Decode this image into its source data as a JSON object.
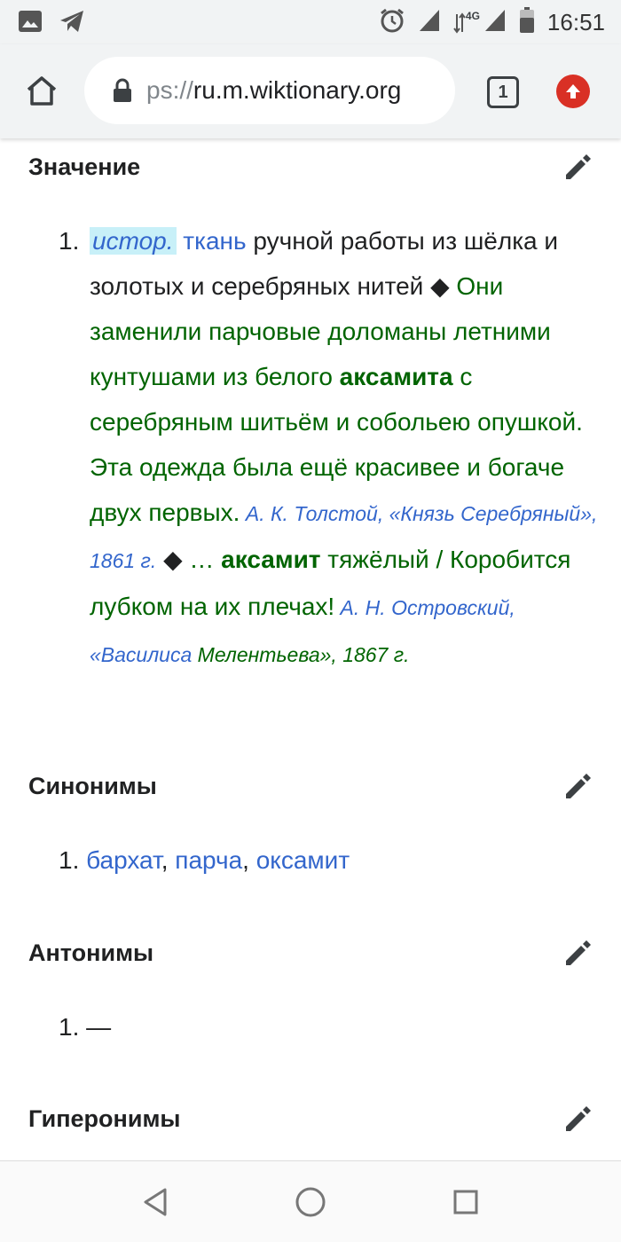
{
  "status_bar": {
    "time": "16:51",
    "network": "4G",
    "icons": [
      "image-icon",
      "telegram-icon",
      "alarm-icon",
      "signal-icon",
      "signal-icon",
      "battery-icon"
    ]
  },
  "browser": {
    "url_scheme": "ps://",
    "url_host": "ru.m.wiktionary.org",
    "tab_count": "1",
    "icons": [
      "home-icon",
      "lock-icon",
      "tab-switcher-icon",
      "update-icon"
    ]
  },
  "sections": {
    "meaning": {
      "title": "Значение",
      "number": "1.",
      "abbr": "истор.",
      "link": "ткань",
      "text": " ручной работы из шёлка и золотых и серебряных нитей ◆ ",
      "ex1_part1": "Они заменили парчовые доломаны летними кунтушами из белого ",
      "ex1_bold": "аксамита",
      "ex1_part2": " с серебряным шитьём и собольею опушкой. Эта одежда была ещё красивее и богаче двух первых.",
      "cite1": " А. К. Толстой, «Князь Серебряный», 1861 г.",
      "sep": " ◆ ",
      "ex2_start": "… ",
      "ex2_bold": "аксамит",
      "ex2_text": " тяжёлый / Коробится лубком на их плечах!",
      "cite2_blue": " А. Н. Островский, «Василиса ",
      "cite2_green": "Мелентьева», 1867 г."
    },
    "synonyms": {
      "title": "Синонимы",
      "number": "1.",
      "items": [
        "бархат",
        "парча",
        "оксамит"
      ],
      "comma": ", "
    },
    "antonyms": {
      "title": "Антонимы",
      "number": "1.",
      "value": "—"
    },
    "hyperonyms": {
      "title": "Гиперонимы"
    }
  },
  "nav": {
    "icons": [
      "back-icon",
      "home-circle-icon",
      "recents-icon"
    ]
  },
  "colors": {
    "link": "#3366cc",
    "example": "#006400",
    "abbr_highlight": "#c8f0f8",
    "update_badge": "#d93025"
  }
}
